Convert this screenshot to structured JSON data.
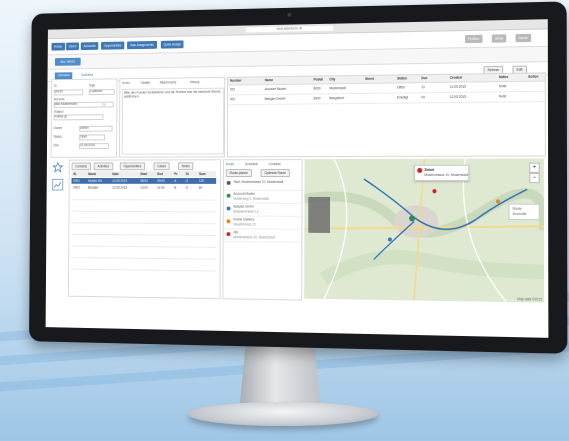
{
  "browser": {
    "url": "www.salesforce.de"
  },
  "nav": {
    "left_buttons": [
      "Home",
      "Users",
      "Accounts",
      "Opportunities",
      "Task Assignments",
      "Quick Assign"
    ],
    "right_buttons": [
      "Profiles",
      "Setup",
      "Admin"
    ]
  },
  "record_tab": {
    "label": "Acc. #0010"
  },
  "subtabs": [
    "Overview",
    "Activities"
  ],
  "actions": [
    "Refresh",
    "Edit"
  ],
  "form": {
    "labels": [
      "ID",
      "Type",
      "Account",
      "Subject",
      "Owner",
      "Status",
      "Due"
    ],
    "values": [
      "00010",
      "Customer",
      "Max Mustermann",
      "Follow up",
      "Admin",
      "Open",
      "12.05.2015"
    ]
  },
  "notes": {
    "tabs": [
      "Notes",
      "Details",
      "Attachments",
      "History"
    ],
    "text": "Bitte den Kunden kontaktieren und die Termine fuer die naechste Woche abstimmen."
  },
  "activity_table": {
    "columns": [
      "Number",
      "Name",
      "Postal",
      "City",
      "Street",
      "Status",
      "Due",
      "Created",
      "Notes",
      "Action"
    ],
    "rows": [
      [
        "001",
        "Account Muster",
        "8000",
        "Musterstadt",
        "",
        "Offen",
        "12",
        "12.05.2015",
        "Notiz",
        ""
      ],
      [
        "002",
        "Beispiel GmbH",
        "6300",
        "Beispielort",
        "",
        "Erledigt",
        "04",
        "12.05.2015",
        "Notiz",
        ""
      ]
    ]
  },
  "lower_tabs": [
    "Contacts",
    "Activities",
    "Opportunities",
    "Cases",
    "Notes"
  ],
  "lower_table": {
    "columns": [
      "ID",
      "Name",
      "Date",
      "Start",
      "End",
      "Pr",
      "St",
      "Sum"
    ],
    "rows": [
      [
        "0001",
        "Muster AG",
        "12.05.2015",
        "08:00",
        "09:00",
        "A",
        "O",
        "120"
      ],
      [
        "0002",
        "Beispiel",
        "12.05.2015",
        "10:00",
        "11:00",
        "B",
        "O",
        "80"
      ]
    ]
  },
  "right_tabs": [
    "Route",
    "Schedule",
    "Contacts"
  ],
  "right_buttons": [
    "Route planen",
    "Optimize Route"
  ],
  "route_list": [
    {
      "title": "Start: Musterstrasse 10, Musterstadt",
      "sub": "",
      "color": "#555555"
    },
    {
      "title": "Account Muster",
      "sub": "Musterweg 5, Musterstadt",
      "color": "#2e8b57"
    },
    {
      "title": "Beispiel GmbH",
      "sub": "Beispielstrasse 12",
      "color": "#3f78b5"
    },
    {
      "title": "Kunde Gamma",
      "sub": "Hauptstrasse 22",
      "color": "#e08a1e"
    },
    {
      "title": "Ziel",
      "sub": "Musterstrasse 10, Musterstadt",
      "color": "#cc2222"
    }
  ],
  "map": {
    "popup_title": "Zielort",
    "popup_sub": "Musterstrasse 10, Musterstadt",
    "legend": [
      "Route",
      "Accounts"
    ],
    "attribution": "Map data ©2015"
  },
  "colors": {
    "accent": "#3f78b5",
    "selected_row": "#3e6fa8",
    "pin_red": "#cc2222"
  }
}
